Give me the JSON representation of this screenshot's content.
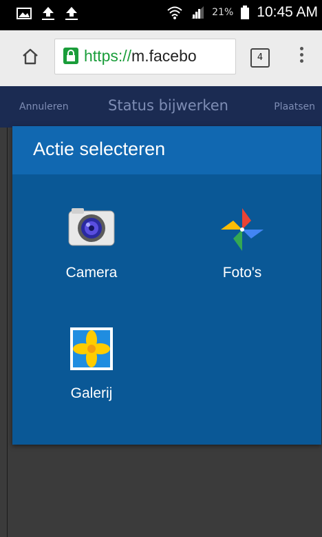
{
  "status_bar": {
    "icons": [
      "gallery-notification-icon",
      "upload-icon",
      "upload-icon",
      "wifi-icon",
      "signal-icon",
      "battery-icon"
    ],
    "battery": "21%",
    "time": "10:45 AM"
  },
  "browser": {
    "url_scheme": "https://",
    "url_host": "m.facebo",
    "tab_count": "4"
  },
  "page_header": {
    "cancel": "Annuleren",
    "title": "Status bijwerken",
    "post": "Plaatsen"
  },
  "dialog": {
    "title": "Actie selecteren",
    "options": [
      {
        "label": "Camera",
        "icon": "camera-icon"
      },
      {
        "label": "Foto's",
        "icon": "pinwheel-photos-icon"
      },
      {
        "label": "Galerij",
        "icon": "gallery-icon"
      }
    ]
  },
  "colors": {
    "dialog_bg": "#0a5896",
    "dialog_header": "#1168b1",
    "fb_header": "#1b2b52",
    "secure_green": "#1a9d3a"
  }
}
